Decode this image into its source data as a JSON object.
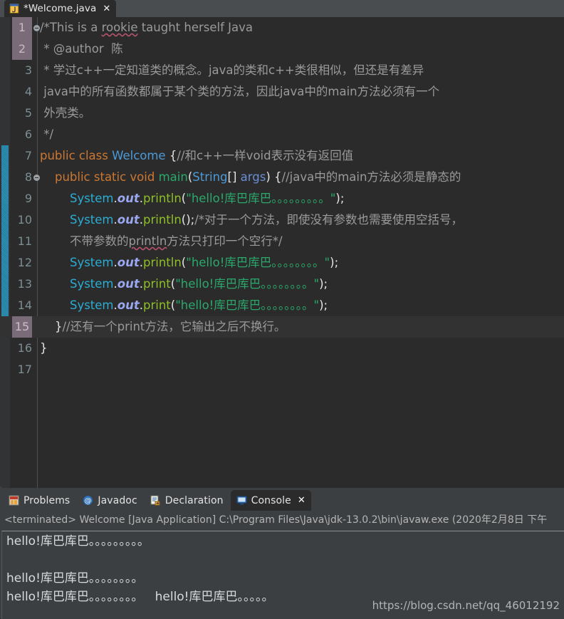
{
  "window": {
    "app": "Eclipse IDE",
    "background_color": "#3c3f41",
    "editor_background": "#2b2b2b"
  },
  "editor_tab": {
    "icon": "java-file-icon",
    "title": "*Welcome.java",
    "close_label": "✕"
  },
  "editor": {
    "gutter_color": "#313335",
    "change_bar_color": "#1b7ea3",
    "selected_line_numbers": [
      1,
      2
    ],
    "current_line": 15,
    "fold_markers": [
      1,
      8
    ],
    "lines": [
      {
        "n": "1",
        "marker": "fold",
        "num_state": "selected",
        "segments": [
          {
            "t": "/*This is a ",
            "c": "cmt"
          },
          {
            "t": "rookie",
            "c": "cmt spell"
          },
          {
            "t": " taught herself Java",
            "c": "cmt"
          }
        ]
      },
      {
        "n": "2",
        "marker": "",
        "num_state": "selected",
        "segments": [
          {
            "t": " * @author  陈",
            "c": "cmt"
          }
        ]
      },
      {
        "n": "3",
        "marker": "",
        "num_state": "",
        "segments": [
          {
            "t": " * 学过c++一定知道类的概念。java的类和c++类很相似，但还是有差异",
            "c": "cmt"
          }
        ]
      },
      {
        "n": "4",
        "marker": "",
        "num_state": "",
        "segments": [
          {
            "t": " java中的所有函数都属于某个类的方法，因此java中的main方法必须有一个",
            "c": "cmt"
          }
        ]
      },
      {
        "n": "5",
        "marker": "",
        "num_state": "",
        "segments": [
          {
            "t": " 外壳类。",
            "c": "cmt"
          }
        ]
      },
      {
        "n": "6",
        "marker": "",
        "num_state": "",
        "segments": [
          {
            "t": " */",
            "c": "cmt"
          }
        ]
      },
      {
        "n": "7",
        "marker": "",
        "num_state": "",
        "segments": [
          {
            "t": "public class ",
            "c": "kw"
          },
          {
            "t": "Welcome",
            "c": "cls"
          },
          {
            "t": " {",
            "c": "plain"
          },
          {
            "t": "//和c++一样void表示没有返回值",
            "c": "cmt"
          }
        ]
      },
      {
        "n": "8",
        "marker": "fold",
        "num_state": "",
        "segments": [
          {
            "t": "    ",
            "c": "plain"
          },
          {
            "t": "public static void ",
            "c": "kw"
          },
          {
            "t": "main",
            "c": "mth-green"
          },
          {
            "t": "(",
            "c": "plain"
          },
          {
            "t": "String",
            "c": "cls"
          },
          {
            "t": "[] ",
            "c": "plain"
          },
          {
            "t": "args",
            "c": "param"
          },
          {
            "t": ") {",
            "c": "plain"
          },
          {
            "t": "//java中的main方法必须是静态的",
            "c": "cmt"
          }
        ]
      },
      {
        "n": "9",
        "marker": "",
        "num_state": "",
        "segments": [
          {
            "t": "        ",
            "c": "plain"
          },
          {
            "t": "System",
            "c": "sys"
          },
          {
            "t": ".",
            "c": "plain"
          },
          {
            "t": "out",
            "c": "fld"
          },
          {
            "t": ".",
            "c": "plain"
          },
          {
            "t": "println",
            "c": "mth"
          },
          {
            "t": "(",
            "c": "plain"
          },
          {
            "t": "\"hello!库巴库巴。。。。。。。。。\"",
            "c": "str"
          },
          {
            "t": ");",
            "c": "plain"
          }
        ]
      },
      {
        "n": "10",
        "marker": "",
        "num_state": "",
        "segments": [
          {
            "t": "        ",
            "c": "plain"
          },
          {
            "t": "System",
            "c": "sys"
          },
          {
            "t": ".",
            "c": "plain"
          },
          {
            "t": "out",
            "c": "fld"
          },
          {
            "t": ".",
            "c": "plain"
          },
          {
            "t": "println",
            "c": "mth"
          },
          {
            "t": "();",
            "c": "plain"
          },
          {
            "t": "/*对于一个方法，即使没有参数也需要使用空括号，",
            "c": "cmt"
          }
        ]
      },
      {
        "n": "11",
        "marker": "",
        "num_state": "",
        "segments": [
          {
            "t": "        不带参数的",
            "c": "cmt"
          },
          {
            "t": "println",
            "c": "cmt spell"
          },
          {
            "t": "方法只打印一个空行*/",
            "c": "cmt"
          }
        ]
      },
      {
        "n": "12",
        "marker": "",
        "num_state": "",
        "segments": [
          {
            "t": "        ",
            "c": "plain"
          },
          {
            "t": "System",
            "c": "sys"
          },
          {
            "t": ".",
            "c": "plain"
          },
          {
            "t": "out",
            "c": "fld"
          },
          {
            "t": ".",
            "c": "plain"
          },
          {
            "t": "println",
            "c": "mth"
          },
          {
            "t": "(",
            "c": "plain"
          },
          {
            "t": "\"hello!库巴库巴。。。。。。。。\"",
            "c": "str"
          },
          {
            "t": ");",
            "c": "plain"
          }
        ]
      },
      {
        "n": "13",
        "marker": "",
        "num_state": "",
        "segments": [
          {
            "t": "        ",
            "c": "plain"
          },
          {
            "t": "System",
            "c": "sys"
          },
          {
            "t": ".",
            "c": "plain"
          },
          {
            "t": "out",
            "c": "fld"
          },
          {
            "t": ".",
            "c": "plain"
          },
          {
            "t": "print",
            "c": "mth"
          },
          {
            "t": "(",
            "c": "plain"
          },
          {
            "t": "\"hello!库巴库巴。。。。。。。。\"",
            "c": "str"
          },
          {
            "t": ");",
            "c": "plain"
          }
        ]
      },
      {
        "n": "14",
        "marker": "",
        "num_state": "",
        "segments": [
          {
            "t": "        ",
            "c": "plain"
          },
          {
            "t": "System",
            "c": "sys"
          },
          {
            "t": ".",
            "c": "plain"
          },
          {
            "t": "out",
            "c": "fld"
          },
          {
            "t": ".",
            "c": "plain"
          },
          {
            "t": "print",
            "c": "mth"
          },
          {
            "t": "(",
            "c": "plain"
          },
          {
            "t": "\"hello!库巴库巴。。。。。。。。\"",
            "c": "str"
          },
          {
            "t": ");",
            "c": "plain"
          }
        ]
      },
      {
        "n": "15",
        "marker": "",
        "num_state": "current",
        "segments": [
          {
            "t": "    }",
            "c": "plain"
          },
          {
            "t": "//还有一个print方法，它输出之后不换行。",
            "c": "cmt"
          }
        ]
      },
      {
        "n": "16",
        "marker": "",
        "num_state": "",
        "segments": [
          {
            "t": "}",
            "c": "plain"
          }
        ]
      },
      {
        "n": "17",
        "marker": "",
        "num_state": "",
        "segments": [
          {
            "t": "",
            "c": "plain"
          }
        ]
      }
    ]
  },
  "panel": {
    "tabs": [
      {
        "label": "Problems",
        "icon": "problems-icon",
        "active": false,
        "closable": false
      },
      {
        "label": "Javadoc",
        "icon": "javadoc-at-icon",
        "active": false,
        "closable": false
      },
      {
        "label": "Declaration",
        "icon": "declaration-icon",
        "active": false,
        "closable": false
      },
      {
        "label": "Console",
        "icon": "console-icon",
        "active": true,
        "closable": true,
        "close_label": "✕"
      }
    ],
    "terminated_line": "<terminated> Welcome [Java Application] C:\\Program Files\\Java\\jdk-13.0.2\\bin\\javaw.exe (2020年2月8日 下午",
    "console_output": [
      "hello!库巴库巴。。。。。。。。。",
      "",
      "hello!库巴库巴。。。。。。。。",
      "hello!库巴库巴。。。。。。。。   hello!库巴库巴。。。。。"
    ],
    "watermark": "https://blog.csdn.net/qq_46012192"
  }
}
